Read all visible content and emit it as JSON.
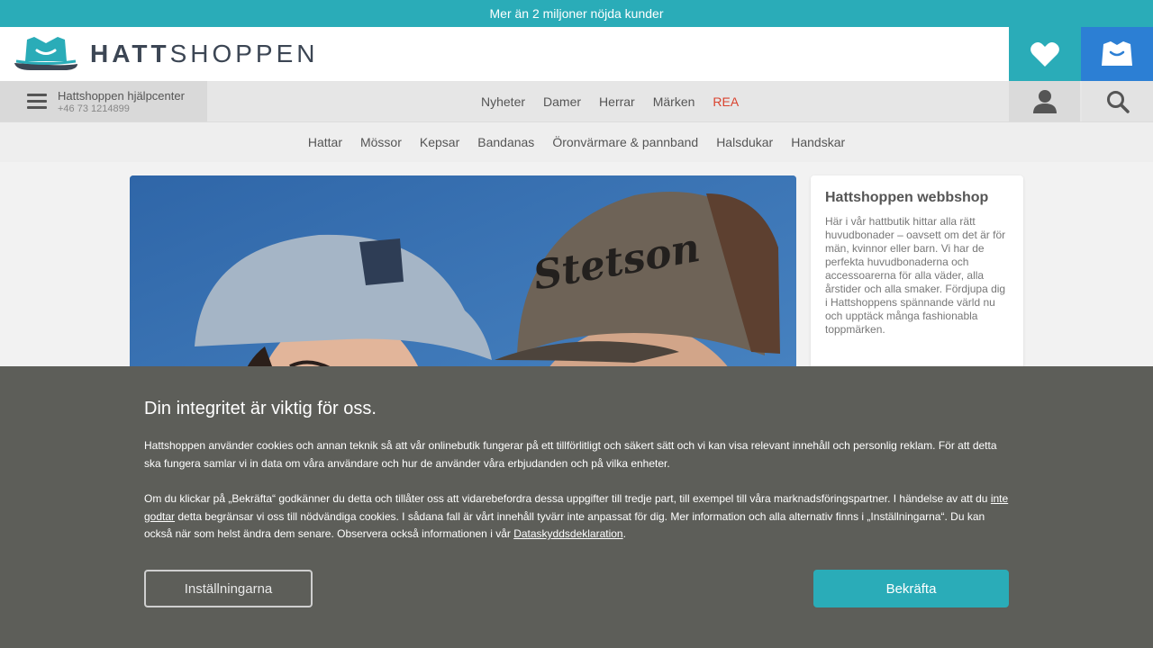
{
  "topbar": {
    "text": "Mer än 2 miljoner nöjda kunder"
  },
  "header": {
    "logo_bold": "HATT",
    "logo_light": "SHOPPEN",
    "wishlist_icon": "heart-icon",
    "cart_icon": "bag-icon"
  },
  "help": {
    "title": "Hattshoppen hjälpcenter",
    "phone": "+46 73 1214899"
  },
  "mainnav": {
    "items": [
      {
        "label": "Nyheter"
      },
      {
        "label": "Damer"
      },
      {
        "label": "Herrar"
      },
      {
        "label": "Märken"
      },
      {
        "label": "REA"
      }
    ]
  },
  "subnav": {
    "items": [
      {
        "label": "Hattar"
      },
      {
        "label": "Mössor"
      },
      {
        "label": "Kepsar"
      },
      {
        "label": "Bandanas"
      },
      {
        "label": "Öronvärmare & pannband"
      },
      {
        "label": "Halsdukar"
      },
      {
        "label": "Handskar"
      }
    ]
  },
  "hero": {
    "cap_text": "Stetson"
  },
  "sidecard": {
    "title": "Hattshoppen webbshop",
    "text": "Här i vår hattbutik hittar alla rätt huvudbonader – oavsett om det är för män, kvinnor eller barn. Vi har de perfekta huvudbonaderna och accessoarerna för alla väder, alla årstider och alla smaker. Fördjupa dig i Hattshoppens spännande värld nu och upptäck många fashionabla toppmärken."
  },
  "cookie": {
    "title": "Din integritet är viktig för oss.",
    "p1": "Hattshoppen använder cookies och annan teknik så att vår onlinebutik fungerar på ett tillförlitligt och säkert sätt och vi kan visa relevant innehåll och personlig reklam. För att detta ska fungera samlar vi in data om våra användare och hur de använder våra erbjudanden och på vilka enheter.",
    "p2_a": "Om du klickar på „Bekräfta“ godkänner du detta och tillåter oss att vidarebefordra dessa uppgifter till tredje part, till exempel till våra marknadsföringspartner. I händelse av att du ",
    "p2_link1": "inte godtar",
    "p2_b": " detta begränsar vi oss till nödvändiga cookies. I sådana fall är vårt innehåll tyvärr inte anpassat för dig. Mer information och alla alternativ finns i „Inställningarna“. Du kan också när som helst ändra dem senare. Observera också informationen i vår ",
    "p2_link2": "Dataskyddsdeklaration",
    "p2_c": ".",
    "settings_label": "Inställningarna",
    "confirm_label": "Bekräfta"
  },
  "colors": {
    "teal": "#2aacb8",
    "blue": "#2c7fd4",
    "sale": "#d9432f",
    "overlay": "#5d5e59"
  }
}
